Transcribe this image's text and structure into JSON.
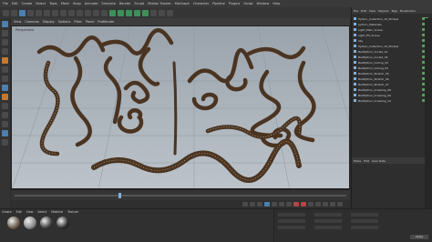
{
  "menu": [
    "File",
    "Edit",
    "Create",
    "Select",
    "Tools",
    "Mesh",
    "Snap",
    "Animate",
    "Simulate",
    "Render",
    "Sculpt",
    "Motion Tracker",
    "MoGraph",
    "Character",
    "Pipeline",
    "Plugins",
    "Script",
    "Window",
    "Help"
  ],
  "viewport": {
    "menu": [
      "View",
      "Cameras",
      "Display",
      "Options",
      "Filter",
      "Panel",
      "ProRender"
    ],
    "label": "Perspective"
  },
  "materials": {
    "tabs": [
      "Create",
      "Edit",
      "View",
      "Select",
      "Material",
      "Texture"
    ],
    "swatch_colors": [
      "#6a5a4a",
      "#888888",
      "#3a3a3a",
      "#2a2a2a"
    ]
  },
  "objects": {
    "tabs": [
      "File",
      "Edit",
      "View",
      "Objects",
      "Tags",
      "Bookmarks"
    ],
    "rows": [
      "Python_Collection_10_Models",
      "python_Materials",
      "Light_Main_Scene",
      "Light_Fill_Scene",
      "Sky",
      "Python_Collection_10_Models",
      "BallPython_Curled_01",
      "BallPython_Curled_02",
      "BallPython_Coiling_03",
      "BallPython_Coiling_04",
      "BallPython_Stretch_05",
      "BallPython_Stretch_06",
      "BallPython_Stretch_07",
      "BallPython_Crawling_08",
      "BallPython_Crawling_09",
      "BallPython_Crawling_10"
    ]
  },
  "attributes": {
    "tabs": [
      "Mode",
      "Edit",
      "User Data"
    ]
  },
  "coords": {
    "apply_label": "Apply"
  },
  "colors": {
    "accent": "#4d7fb0",
    "record": "#b34646",
    "viewport_top": "#9aa3ac",
    "viewport_bottom": "#bcc3ca",
    "snake": "#4a3421"
  }
}
